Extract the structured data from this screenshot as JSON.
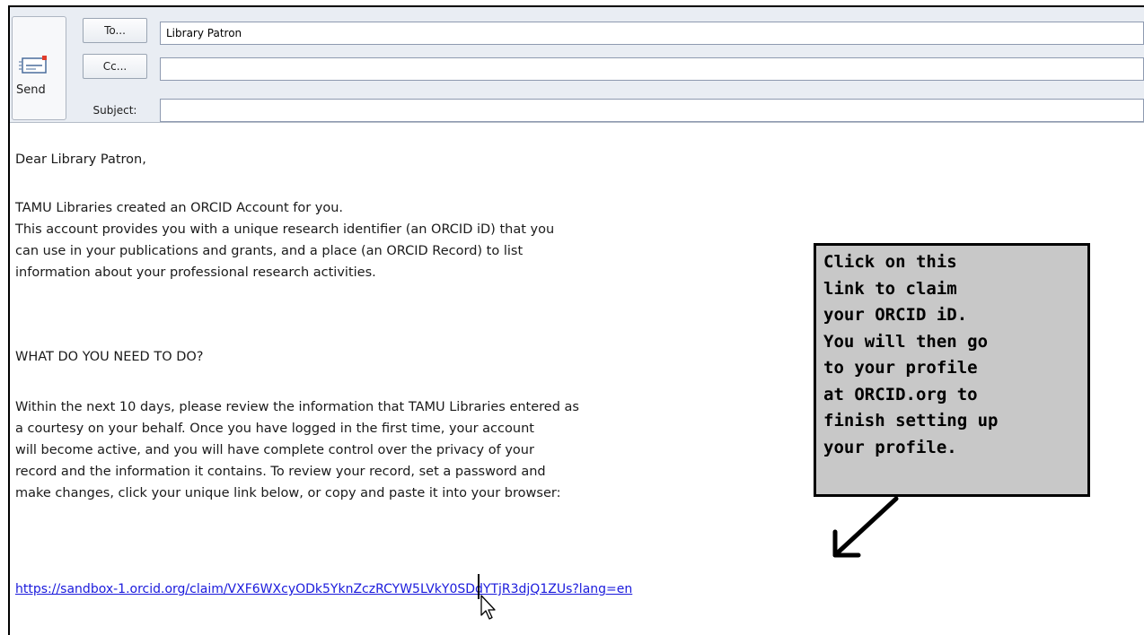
{
  "compose": {
    "send_label": "Send",
    "to_button": "To...",
    "cc_button": "Cc...",
    "subject_label": "Subject:",
    "to_value": "Library Patron",
    "cc_value": "",
    "subject_value": ""
  },
  "message": {
    "greeting": "Dear Library Patron,",
    "paragraph1": [
      "TAMU Libraries created an ORCID Account for you.",
      "This account provides you with a unique research identifier (an ORCID iD) that you",
      "can use in your publications and grants, and a place (an ORCID Record) to list",
      "information about your professional research activities."
    ],
    "heading": "WHAT DO YOU NEED TO DO?",
    "paragraph2": [
      "Within the next 10 days, please review the information that TAMU Libraries entered as",
      "a courtesy on your behalf. Once you have logged in the first time, your account",
      "will become active, and you will have complete control over the privacy of your",
      "record and the information it contains. To review your record, set a password and",
      "make changes, click your unique link below, or copy and paste it into your browser:"
    ],
    "claim_link": "https://sandbox-1.orcid.org/claim/VXF6WXcyODk5YknZczRCYW5LVkY0SDdYTjR3djQ1ZUs?lang=en"
  },
  "callout": {
    "lines": [
      "Click on this",
      "link to claim",
      "your ORCID iD.",
      "You will then go",
      "to your profile",
      "at ORCID.org to",
      "finish setting up",
      "your profile."
    ]
  },
  "icons": {
    "send": "send-envelope-icon",
    "arrow": "arrow-down-left-icon",
    "cursor": "mouse-pointer-icon"
  },
  "colors": {
    "link": "#1a1adc",
    "callout_bg": "#c8c8c8",
    "header_bg": "#e9edf3"
  }
}
